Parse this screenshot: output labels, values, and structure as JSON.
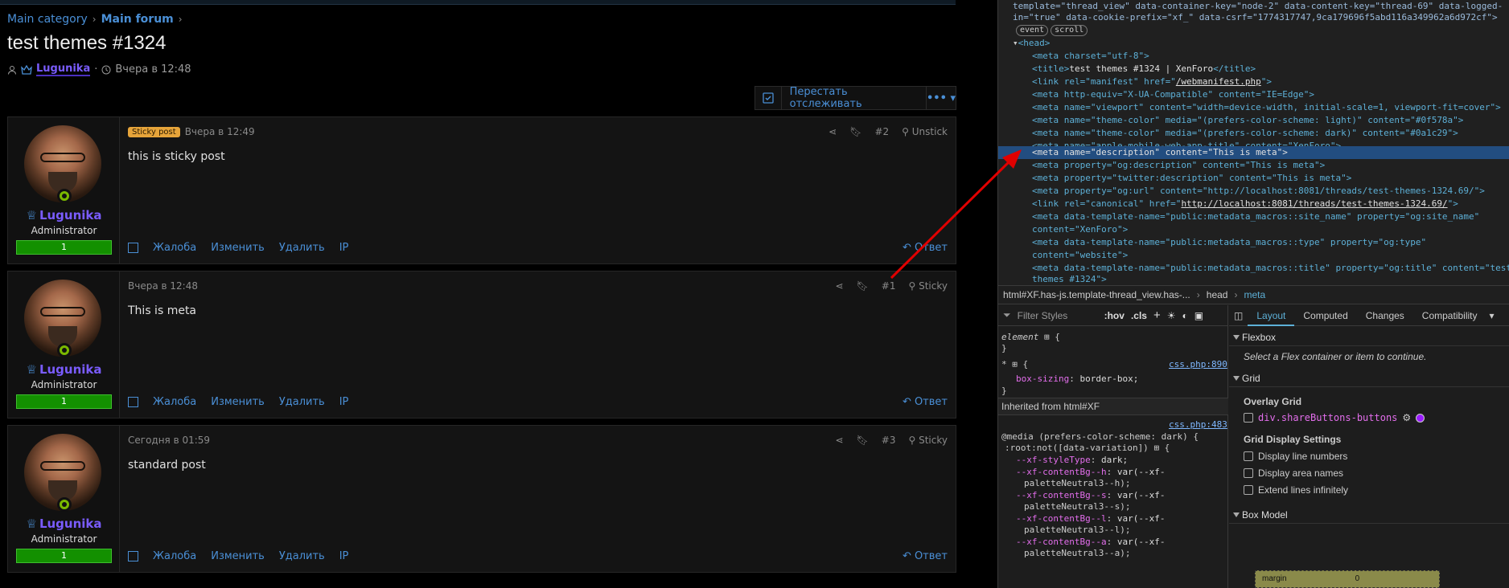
{
  "breadcrumb": {
    "items": [
      "Main category",
      "Main forum"
    ]
  },
  "thread": {
    "title": "test themes #1324",
    "author": "Lugunika",
    "date": "Вчера в 12:48"
  },
  "watch": {
    "label": "Перестать отслеживать",
    "more": "•••"
  },
  "user": {
    "name": "Lugunika",
    "title": "Administrator",
    "bar": "1"
  },
  "posts": [
    {
      "badge": "Sticky post",
      "date": "Вчера в 12:49",
      "num": "#2",
      "action": "Unstick",
      "body": "this is sticky post"
    },
    {
      "date": "Вчера в 12:48",
      "num": "#1",
      "action": "Sticky",
      "body": "This is meta"
    },
    {
      "date": "Сегодня в 01:59",
      "num": "#3",
      "action": "Sticky",
      "body": "standard post"
    }
  ],
  "post_actions": {
    "report": "Жалоба",
    "edit": "Изменить",
    "delete": "Удалить",
    "ip": "IP",
    "reply": "Ответ"
  },
  "dom": {
    "line1": "template=\"thread_view\" data-container-key=\"node-2\" data-content-key=\"thread-69\" data-logged-",
    "line2": "in=\"true\" data-cookie-prefix=\"xf_\" data-csrf=\"1774317747,9ca179696f5abd116a349962a6d972cf\">",
    "pill_event": "event",
    "pill_scroll": "scroll",
    "head": "<head>",
    "m1": "<meta charset=\"utf-8\">",
    "m2_pre": "<title>",
    "m2_text": "test themes #1324 | XenForo",
    "m2_post": "</title>",
    "m3_pre": "<link rel=\"manifest\" href=\"",
    "m3_link": "/webmanifest.php",
    "m3_post": "\">",
    "m4": "<meta http-equiv=\"X-UA-Compatible\" content=\"IE=Edge\">",
    "m5": "<meta name=\"viewport\" content=\"width=device-width, initial-scale=1, viewport-fit=cover\">",
    "m6": "<meta name=\"theme-color\" media=\"(prefers-color-scheme: light)\" content=\"#0f578a\">",
    "m7": "<meta name=\"theme-color\" media=\"(prefers-color-scheme: dark)\" content=\"#0a1c29\">",
    "m8": "<meta name=\"apple-mobile-web-app-title\" content=\"XenForo\">",
    "m9": "<meta name=\"description\" content=\"This is meta\">",
    "m10": "<meta property=\"og:description\" content=\"This is meta\">",
    "m11": "<meta property=\"twitter:description\" content=\"This is meta\">",
    "m12": "<meta property=\"og:url\" content=\"http://localhost:8081/threads/test-themes-1324.69/\">",
    "m13_pre": "<link rel=\"canonical\" href=\"",
    "m13_link": "http://localhost:8081/threads/test-themes-1324.69/",
    "m13_post": "\">",
    "m14a": "<meta data-template-name=\"public:metadata_macros::site_name\" property=\"og:site_name\"",
    "m14b": "content=\"XenForo\">",
    "m15a": "<meta data-template-name=\"public:metadata_macros::type\" property=\"og:type\"",
    "m15b": "content=\"website\">",
    "m16a": "<meta data-template-name=\"public:metadata_macros::title\" property=\"og:title\" content=\"test",
    "m16b": "themes #1324\">"
  },
  "devbreadcrumb": {
    "html": "html#XF.has-js.template-thread_view.has-...",
    "head": "head",
    "meta": "meta"
  },
  "styles": {
    "filter_placeholder": "Filter Styles",
    "hov": ":hov",
    "cls": ".cls",
    "element": "element",
    "star": "*",
    "link1": "css.php:890",
    "box_prop": "box-sizing",
    "box_val": "border-box;",
    "inherited": "Inherited from html#XF",
    "link2": "css.php:483",
    "media1": "@media (prefers-color-scheme: dark) {",
    "media2": ":root:not([data-variation])",
    "v1p": "--xf-styleType",
    "v1v": "dark;",
    "v2p": "--xf-contentBg--h",
    "v2v": "var(--xf-",
    "v2c": "paletteNeutral3--h);",
    "v3p": "--xf-contentBg--s",
    "v3v": "var(--xf-",
    "v3c": "paletteNeutral3--s);",
    "v4p": "--xf-contentBg--l",
    "v4v": "var(--xf-",
    "v4c": "paletteNeutral3--l);",
    "v5p": "--xf-contentBg--a",
    "v5v": "var(--xf-",
    "v5c": "paletteNeutral3--a);"
  },
  "layout": {
    "tabs": [
      "Layout",
      "Computed",
      "Changes",
      "Compatibility"
    ],
    "flexbox": "Flexbox",
    "flex_hint": "Select a Flex container or item to continue.",
    "grid": "Grid",
    "overlay": "Overlay Grid",
    "overlay_item": "div.shareButtons-buttons",
    "settings": "Grid Display Settings",
    "opt1": "Display line numbers",
    "opt2": "Display area names",
    "opt3": "Extend lines infinitely",
    "boxmodel": "Box Model",
    "margin": "margin",
    "margin_val": "0"
  },
  "colors": {
    "accent": "#4a8fd6",
    "username": "#7a5cff",
    "highlight": "#224d80",
    "arrow": "#e00000"
  }
}
